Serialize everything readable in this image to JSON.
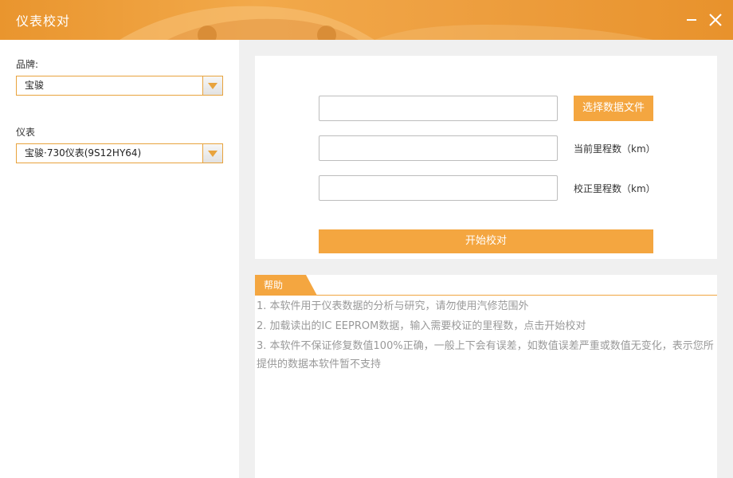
{
  "window": {
    "title": "仪表校对",
    "accent_color": "#f4a640",
    "titlebar_color": "#eea041"
  },
  "sidebar": {
    "brand_label": "品牌:",
    "brand_value": "宝骏",
    "meter_label": "仪表",
    "meter_value": "宝骏·730仪表(9S12HY64)"
  },
  "form": {
    "file_input_value": "",
    "choose_file_label": "选择数据文件",
    "current_mileage_value": "",
    "current_mileage_label": "当前里程数（km）",
    "corrected_mileage_value": "",
    "corrected_mileage_label": "校正里程数（km）",
    "start_label": "开始校对"
  },
  "help": {
    "tab_label": "帮助",
    "lines": [
      "1. 本软件用于仪表数据的分析与研究，请勿使用汽修范围外",
      "2. 加载读出的IC EEPROM数据，输入需要校证的里程数，点击开始校对",
      "3. 本软件不保证修复数值100%正确，一般上下会有误差，如数值误差严重或数值无变化，表示您所提供的数据本软件暂不支持"
    ]
  }
}
